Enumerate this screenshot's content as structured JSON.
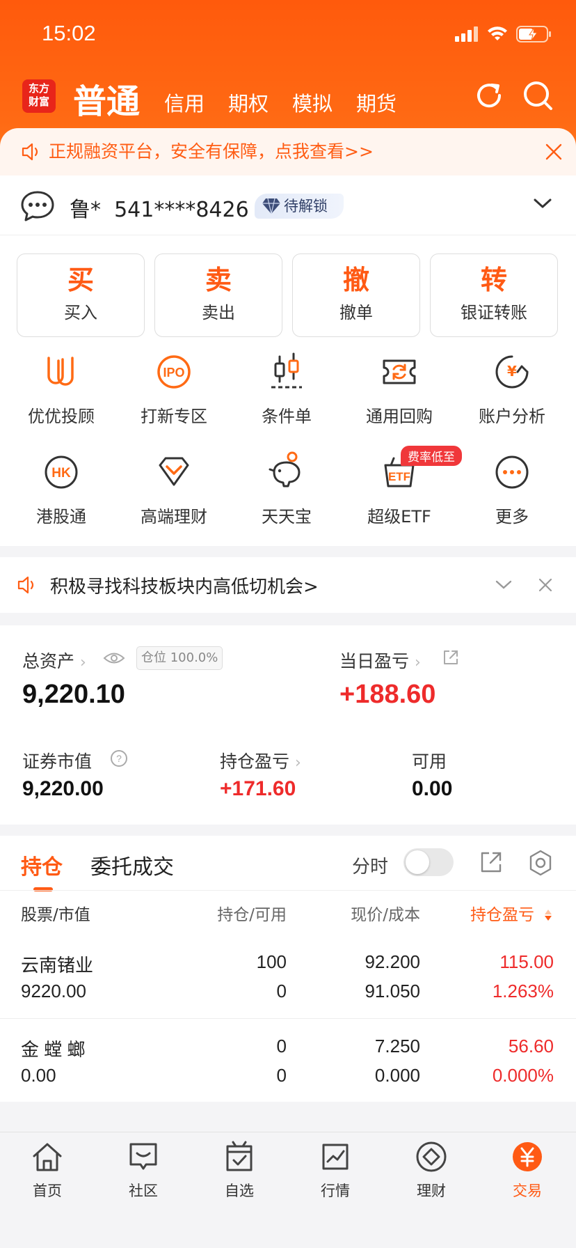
{
  "status": {
    "time": "15:02"
  },
  "nav": {
    "logo_line1": "东方",
    "logo_line2": "财富",
    "active_tab": "普通",
    "tabs": [
      "信用",
      "期权",
      "模拟",
      "期货"
    ]
  },
  "notice": {
    "text": "正规融资平台，安全有保障，点我查看>>"
  },
  "account": {
    "name": "鲁*",
    "number": "541****8426",
    "badge": "待解锁"
  },
  "actions": [
    {
      "big": "买",
      "label": "买入"
    },
    {
      "big": "卖",
      "label": "卖出"
    },
    {
      "big": "撤",
      "label": "撤单"
    },
    {
      "big": "转",
      "label": "银证转账"
    }
  ],
  "grid_row1": [
    "优优投顾",
    "打新专区",
    "条件单",
    "通用回购",
    "账户分析"
  ],
  "grid_row2": [
    "港股通",
    "高端理财",
    "天天宝",
    "超级ETF",
    "更多"
  ],
  "grid_badge": "费率低至",
  "tip": {
    "text": "积极寻找科技板块内高低切机会>"
  },
  "assets": {
    "total_label": "总资产",
    "position_chip": "仓位 100.0%",
    "total_value": "9,220.10",
    "daily_label": "当日盈亏",
    "daily_value": "+188.60",
    "market_label": "证券市值",
    "market_value": "9,220.00",
    "hold_pl_label": "持仓盈亏",
    "hold_pl_value": "+171.60",
    "avail_label": "可用",
    "avail_value": "0.00"
  },
  "holdings": {
    "tab_active": "持仓",
    "tab_other": "委托成交",
    "fenshi": "分时",
    "headers": {
      "stock": "股票/市值",
      "hold": "持仓/可用",
      "price": "现价/成本",
      "pl": "持仓盈亏"
    },
    "rows": [
      {
        "name": "云南锗业",
        "mv": "9220.00",
        "hold": "100",
        "avail": "0",
        "price": "92.200",
        "cost": "91.050",
        "pl": "115.00",
        "plpct": "1.263%"
      },
      {
        "name": "金 螳 螂",
        "mv": "0.00",
        "hold": "0",
        "avail": "0",
        "price": "7.250",
        "cost": "0.000",
        "pl": "56.60",
        "plpct": "0.000%"
      }
    ]
  },
  "tabbar": [
    {
      "label": "首页"
    },
    {
      "label": "社区"
    },
    {
      "label": "自选"
    },
    {
      "label": "行情"
    },
    {
      "label": "理财"
    },
    {
      "label": "交易"
    }
  ],
  "colors": {
    "accent": "#ff5a14",
    "gain": "#ee2b2b"
  }
}
